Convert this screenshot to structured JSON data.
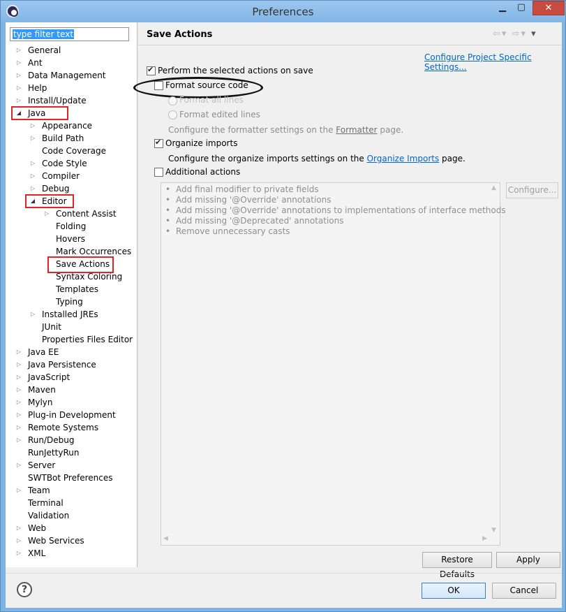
{
  "window": {
    "title": "Preferences"
  },
  "filter": {
    "placeholder": "type filter text"
  },
  "tree": [
    {
      "label": "General",
      "level": 0,
      "arrow": "collapsed"
    },
    {
      "label": "Ant",
      "level": 0,
      "arrow": "collapsed"
    },
    {
      "label": "Data Management",
      "level": 0,
      "arrow": "collapsed"
    },
    {
      "label": "Help",
      "level": 0,
      "arrow": "collapsed"
    },
    {
      "label": "Install/Update",
      "level": 0,
      "arrow": "collapsed"
    },
    {
      "label": "Java",
      "level": 0,
      "arrow": "expanded"
    },
    {
      "label": "Appearance",
      "level": 1,
      "arrow": "collapsed"
    },
    {
      "label": "Build Path",
      "level": 1,
      "arrow": "collapsed"
    },
    {
      "label": "Code Coverage",
      "level": 1,
      "arrow": "none"
    },
    {
      "label": "Code Style",
      "level": 1,
      "arrow": "collapsed"
    },
    {
      "label": "Compiler",
      "level": 1,
      "arrow": "collapsed"
    },
    {
      "label": "Debug",
      "level": 1,
      "arrow": "collapsed"
    },
    {
      "label": "Editor",
      "level": 1,
      "arrow": "expanded"
    },
    {
      "label": "Content Assist",
      "level": 2,
      "arrow": "collapsed"
    },
    {
      "label": "Folding",
      "level": 2,
      "arrow": "none"
    },
    {
      "label": "Hovers",
      "level": 2,
      "arrow": "none"
    },
    {
      "label": "Mark Occurrences",
      "level": 2,
      "arrow": "none"
    },
    {
      "label": "Save Actions",
      "level": 2,
      "arrow": "none"
    },
    {
      "label": "Syntax Coloring",
      "level": 2,
      "arrow": "none"
    },
    {
      "label": "Templates",
      "level": 2,
      "arrow": "none"
    },
    {
      "label": "Typing",
      "level": 2,
      "arrow": "none"
    },
    {
      "label": "Installed JREs",
      "level": 1,
      "arrow": "collapsed"
    },
    {
      "label": "JUnit",
      "level": 1,
      "arrow": "none"
    },
    {
      "label": "Properties Files Editor",
      "level": 1,
      "arrow": "none"
    },
    {
      "label": "Java EE",
      "level": 0,
      "arrow": "collapsed"
    },
    {
      "label": "Java Persistence",
      "level": 0,
      "arrow": "collapsed"
    },
    {
      "label": "JavaScript",
      "level": 0,
      "arrow": "collapsed"
    },
    {
      "label": "Maven",
      "level": 0,
      "arrow": "collapsed"
    },
    {
      "label": "Mylyn",
      "level": 0,
      "arrow": "collapsed"
    },
    {
      "label": "Plug-in Development",
      "level": 0,
      "arrow": "collapsed"
    },
    {
      "label": "Remote Systems",
      "level": 0,
      "arrow": "collapsed"
    },
    {
      "label": "Run/Debug",
      "level": 0,
      "arrow": "collapsed"
    },
    {
      "label": "RunJettyRun",
      "level": 0,
      "arrow": "none"
    },
    {
      "label": "Server",
      "level": 0,
      "arrow": "collapsed"
    },
    {
      "label": "SWTBot Preferences",
      "level": 0,
      "arrow": "none"
    },
    {
      "label": "Team",
      "level": 0,
      "arrow": "collapsed"
    },
    {
      "label": "Terminal",
      "level": 0,
      "arrow": "none"
    },
    {
      "label": "Validation",
      "level": 0,
      "arrow": "none"
    },
    {
      "label": "Web",
      "level": 0,
      "arrow": "collapsed"
    },
    {
      "label": "Web Services",
      "level": 0,
      "arrow": "collapsed"
    },
    {
      "label": "XML",
      "level": 0,
      "arrow": "collapsed"
    }
  ],
  "panel": {
    "title": "Save Actions",
    "configure_link": "Configure Project Specific Settings...",
    "perform_label": "Perform the selected actions on save",
    "perform_checked": true,
    "format_label": "Format source code",
    "format_checked": false,
    "format_all_label": "Format all lines",
    "format_edited_label": "Format edited lines",
    "formatter_text_before": "Configure the formatter settings on the ",
    "formatter_link": "Formatter",
    "formatter_text_after": " page.",
    "organize_label": "Organize imports",
    "organize_checked": true,
    "organize_text_before": "Configure the organize imports settings on the ",
    "organize_link": "Organize Imports",
    "organize_text_after": " page.",
    "additional_label": "Additional actions",
    "additional_checked": false,
    "additional_items": [
      "Add final modifier to private fields",
      "Add missing '@Override' annotations",
      "Add missing '@Override' annotations to implementations of interface methods",
      "Add missing '@Deprecated' annotations",
      "Remove unnecessary casts"
    ],
    "configure_button": "Configure...",
    "restore_button": "Restore Defaults",
    "apply_button": "Apply"
  },
  "footer": {
    "help_symbol": "?",
    "ok_button": "OK",
    "cancel_button": "Cancel"
  },
  "colors": {
    "annotation_red": "#e0242a",
    "link_blue": "#0066cc"
  }
}
